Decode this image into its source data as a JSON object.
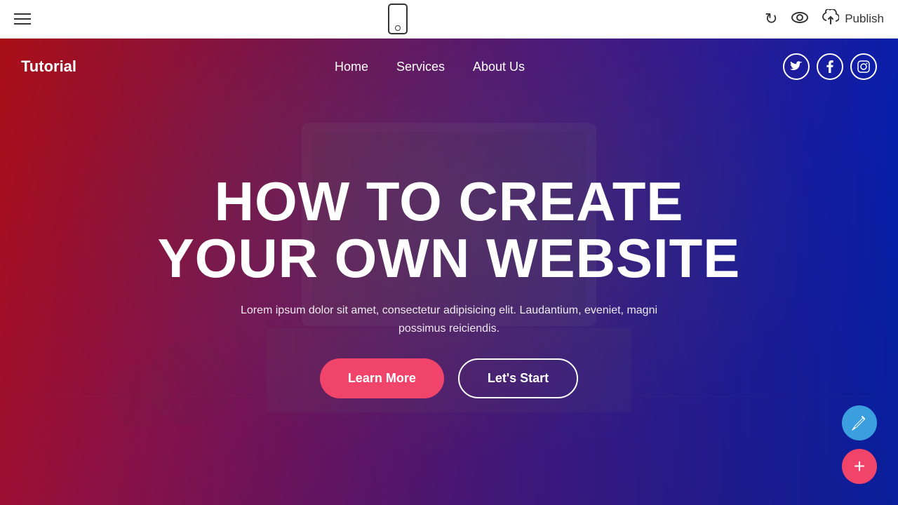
{
  "toolbar": {
    "hamburger_label": "menu",
    "undo_label": "↺",
    "eye_symbol": "👁",
    "publish_label": "Publish",
    "publish_icon": "☁"
  },
  "site": {
    "logo": "Tutorial",
    "nav": {
      "links": [
        {
          "label": "Home"
        },
        {
          "label": "Services"
        },
        {
          "label": "About Us"
        }
      ],
      "socials": [
        {
          "label": "Twitter",
          "icon": "𝕋"
        },
        {
          "label": "Facebook",
          "icon": "f"
        },
        {
          "label": "Instagram",
          "icon": "📷"
        }
      ]
    },
    "hero": {
      "title_line1": "HOW TO CREATE",
      "title_line2": "YOUR OWN WEBSITE",
      "subtitle": "Lorem ipsum dolor sit amet, consectetur adipisicing elit. Laudantium, eveniet, magni possimus reiciendis.",
      "btn_primary": "Learn More",
      "btn_secondary": "Let's Start"
    }
  },
  "fab": {
    "pencil_label": "✏",
    "add_label": "+"
  }
}
